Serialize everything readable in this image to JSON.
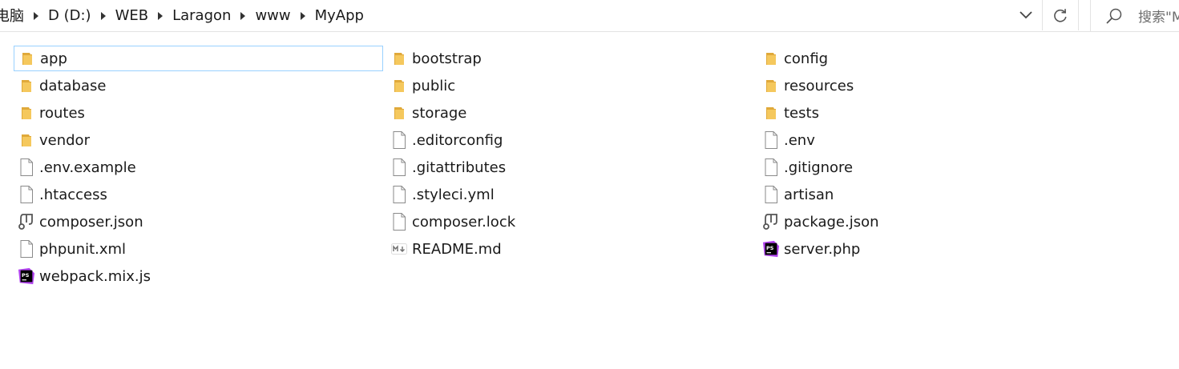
{
  "breadcrumb": {
    "items": [
      "电脑",
      "D (D:)",
      "WEB",
      "Laragon",
      "www",
      "MyApp"
    ]
  },
  "search": {
    "placeholder": "搜索\"M"
  },
  "files": [
    {
      "name": "app",
      "type": "folder",
      "icon": "folder-icon",
      "selected": true
    },
    {
      "name": "bootstrap",
      "type": "folder",
      "icon": "folder-icon"
    },
    {
      "name": "config",
      "type": "folder",
      "icon": "folder-icon"
    },
    {
      "name": "database",
      "type": "folder",
      "icon": "folder-icon"
    },
    {
      "name": "public",
      "type": "folder",
      "icon": "folder-icon"
    },
    {
      "name": "resources",
      "type": "folder",
      "icon": "folder-icon"
    },
    {
      "name": "routes",
      "type": "folder",
      "icon": "folder-icon"
    },
    {
      "name": "storage",
      "type": "folder",
      "icon": "folder-icon"
    },
    {
      "name": "tests",
      "type": "folder",
      "icon": "folder-icon"
    },
    {
      "name": "vendor",
      "type": "folder",
      "icon": "folder-icon"
    },
    {
      "name": ".editorconfig",
      "type": "file",
      "icon": "blank-file-icon"
    },
    {
      "name": ".env",
      "type": "file",
      "icon": "blank-file-icon"
    },
    {
      "name": ".env.example",
      "type": "file",
      "icon": "blank-file-icon"
    },
    {
      "name": ".gitattributes",
      "type": "file",
      "icon": "blank-file-icon"
    },
    {
      "name": ".gitignore",
      "type": "file",
      "icon": "blank-file-icon"
    },
    {
      "name": ".htaccess",
      "type": "file",
      "icon": "blank-file-icon"
    },
    {
      "name": ".styleci.yml",
      "type": "file",
      "icon": "blank-file-icon"
    },
    {
      "name": "artisan",
      "type": "file",
      "icon": "blank-file-icon"
    },
    {
      "name": "composer.json",
      "type": "file",
      "icon": "json-file-icon"
    },
    {
      "name": "composer.lock",
      "type": "file",
      "icon": "blank-file-icon"
    },
    {
      "name": "package.json",
      "type": "file",
      "icon": "json-file-icon"
    },
    {
      "name": "phpunit.xml",
      "type": "file",
      "icon": "blank-file-icon"
    },
    {
      "name": "README.md",
      "type": "file",
      "icon": "markdown-file-icon"
    },
    {
      "name": "server.php",
      "type": "file",
      "icon": "phpstorm-file-icon"
    },
    {
      "name": "webpack.mix.js",
      "type": "file",
      "icon": "phpstorm-file-icon"
    }
  ],
  "colors": {
    "folder": "#f5c85d",
    "folder_dark": "#e0a93a",
    "selection_border": "#99d1ff",
    "phpstorm_bg": "#000000",
    "phpstorm_accent": "#b345f1"
  }
}
